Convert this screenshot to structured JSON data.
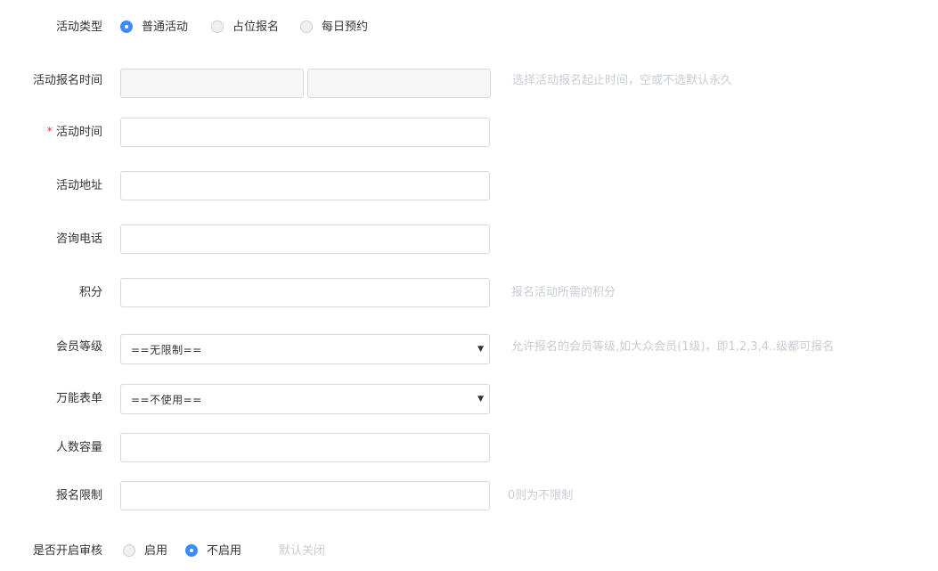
{
  "activity_type": {
    "label": "活动类型",
    "options": [
      "普通活动",
      "占位报名",
      "每日预约"
    ],
    "selected": 0
  },
  "signup_time": {
    "label": "活动报名时间",
    "start_value": "",
    "end_value": "",
    "hint": "选择活动报名起止时间，空或不选默认永久"
  },
  "activity_time": {
    "required_mark": "*",
    "label": "活动时间",
    "value": ""
  },
  "address": {
    "label": "活动地址",
    "value": ""
  },
  "phone": {
    "label": "咨询电话",
    "value": ""
  },
  "points": {
    "label": "积分",
    "value": "",
    "hint": "报名活动所需的积分"
  },
  "member_level": {
    "label": "会员等级",
    "selected_value": "==无限制==",
    "hint": "允许报名的会员等级,如大众会员(1级)，即1,2,3,4..级都可报名"
  },
  "universal_form": {
    "label": "万能表单",
    "selected_value": "==不使用=="
  },
  "capacity": {
    "label": "人数容量",
    "value": ""
  },
  "signup_limit": {
    "label": "报名限制",
    "value": "",
    "hint": "0则为不限制"
  },
  "review": {
    "label": "是否开启审核",
    "options": [
      "启用",
      "不启用"
    ],
    "selected": 1,
    "hint": "默认关闭"
  },
  "colors": {
    "accent": "#3d8bfd",
    "required": "#e5383b",
    "hint": "#c8ccd4"
  },
  "icons": {
    "select_arrow": "caret-down-icon"
  }
}
